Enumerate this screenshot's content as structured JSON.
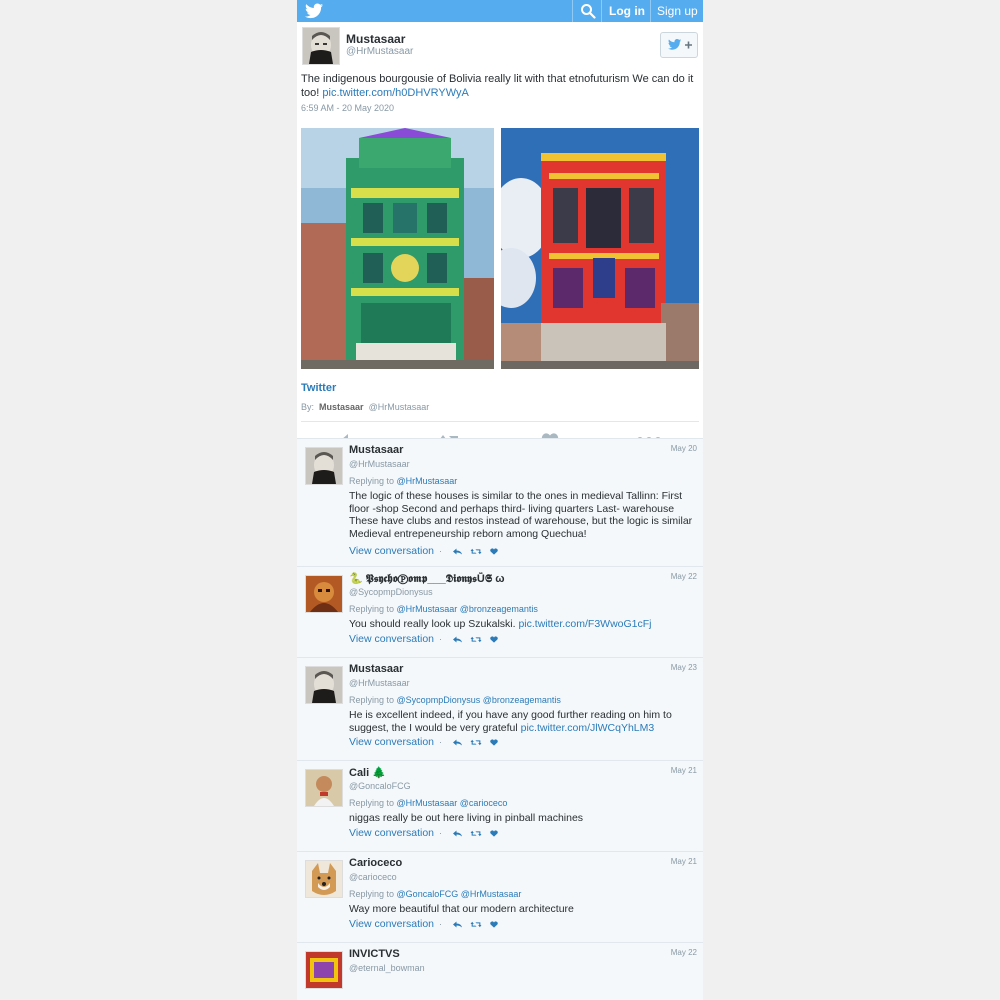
{
  "topbar": {
    "login": "Log in",
    "signup": "Sign up",
    "icons": [
      "twitter-bird-icon",
      "search-icon"
    ]
  },
  "main_tweet": {
    "name": "Mustasaar",
    "handle": "@HrMustasaar",
    "text": "The indigenous bourgousie of Bolivia really lit with that etnofuturism We can do it too!",
    "link": "pic.twitter.com/h0DHVRYWyA",
    "timestamp": "6:59 AM - 20 May 2020",
    "card_title": "Twitter",
    "by_label": "By:",
    "by_name": "Mustasaar",
    "by_handle": "@HrMustasaar"
  },
  "replies": [
    {
      "name": "Mustasaar",
      "handle": "@HrMustasaar",
      "date": "May 20",
      "replying_label": "Replying to",
      "replying_to": "@HrMustasaar",
      "text": "The logic of these houses is similar to the ones in medieval Tallinn: First floor -shop Second and perhaps third- living quarters Last- warehouse These have clubs and restos instead of warehouse, but the logic is similar Medieval entrepeneurship reborn among Quechua!",
      "link": "",
      "view": "View conversation"
    },
    {
      "name": "🐍 𝕻𝖘𝖞𝖈𝖍𝖔Ⓟ𝖔𝖒𝖕___𝕯𝖎𝖔𝖓𝖞𝖘Ṻ𝕾 ω",
      "handle": "@SycopmpDionysus",
      "date": "May 22",
      "replying_label": "Replying to",
      "replying_to": "@HrMustasaar @bronzeagemantis",
      "text": "You should really look up Szukalski.",
      "link": "pic.twitter.com/F3WwoG1cFj",
      "view": "View conversation"
    },
    {
      "name": "Mustasaar",
      "handle": "@HrMustasaar",
      "date": "May 23",
      "replying_label": "Replying to",
      "replying_to": "@SycopmpDionysus @bronzeagemantis",
      "text": "He is excellent indeed, if you have any good further reading on him to suggest, the I would be very grateful",
      "link": "pic.twitter.com/JlWCqYhLM3",
      "view": "View conversation"
    },
    {
      "name": "Cali 🌲",
      "handle": "@GoncaloFCG",
      "date": "May 21",
      "replying_label": "Replying to",
      "replying_to": "@HrMustasaar @carioceco",
      "text": "niggas really be out here living in pinball machines",
      "link": "",
      "view": "View conversation"
    },
    {
      "name": "Carioceco",
      "handle": "@carioceco",
      "date": "May 21",
      "replying_label": "Replying to",
      "replying_to": "@GoncaloFCG @HrMustasaar",
      "text": "Way more beautiful that our modern architecture",
      "link": "",
      "view": "View conversation"
    },
    {
      "name": "INVICTVS",
      "handle": "@eternal_bowman",
      "date": "May 22",
      "replying_label": "",
      "replying_to": "",
      "text": "",
      "link": "",
      "view": ""
    }
  ],
  "colors": {
    "accent": "#55acee",
    "link": "#2b7bb9",
    "muted": "#8899a6"
  }
}
